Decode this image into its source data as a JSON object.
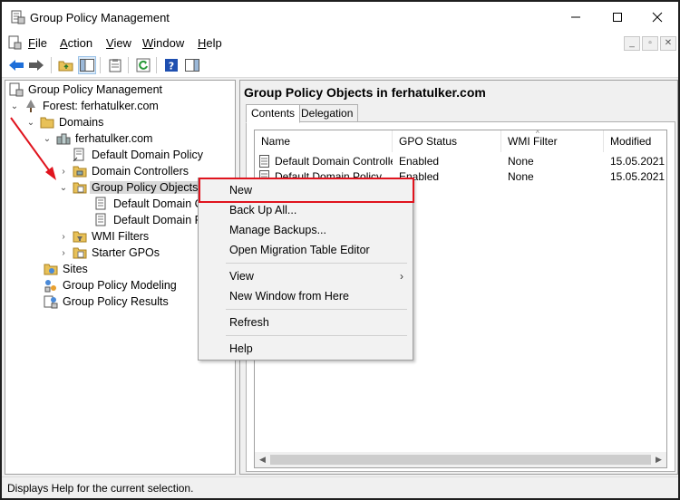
{
  "window": {
    "title": "Group Policy Management"
  },
  "menubar": {
    "items": [
      "File",
      "Action",
      "View",
      "Window",
      "Help"
    ],
    "mnemonics": [
      "F",
      "A",
      "V",
      "W",
      "H"
    ]
  },
  "tree": {
    "root": "Group Policy Management",
    "forest": "Forest: ferhatulker.com",
    "domains": "Domains",
    "domain": "ferhatulker.com",
    "default_domain_policy": "Default Domain Policy",
    "domain_controllers": "Domain Controllers",
    "gpo_container": "Group Policy Objects",
    "gpo_child_1": "Default Domain C",
    "gpo_child_2": "Default Domain P",
    "wmi_filters": "WMI Filters",
    "starter_gpos": "Starter GPOs",
    "sites": "Sites",
    "modeling": "Group Policy Modeling",
    "results": "Group Policy Results"
  },
  "right_pane": {
    "title": "Group Policy Objects in ferhatulker.com",
    "tabs": [
      "Contents",
      "Delegation"
    ],
    "columns": [
      "Name",
      "GPO Status",
      "WMI Filter",
      "Modified"
    ],
    "rows": [
      {
        "name": "Default Domain Controller...",
        "status": "Enabled",
        "wmi": "None",
        "modified": "15.05.2021"
      },
      {
        "name": "Default Domain Policy",
        "status": "Enabled",
        "wmi": "None",
        "modified": "15.05.2021"
      }
    ]
  },
  "context_menu": {
    "new": "New",
    "backup_all": "Back Up All...",
    "manage_backups": "Manage Backups...",
    "migration": "Open Migration Table Editor",
    "view": "View",
    "new_window": "New Window from Here",
    "refresh": "Refresh",
    "help": "Help"
  },
  "status": {
    "text": "Displays Help for the current selection."
  },
  "colors": {
    "highlight": "#e0141e",
    "selection": "#d9d9d9",
    "toolbar_blue": "#1e6fd9",
    "folder_yellow": "#e8c158"
  }
}
